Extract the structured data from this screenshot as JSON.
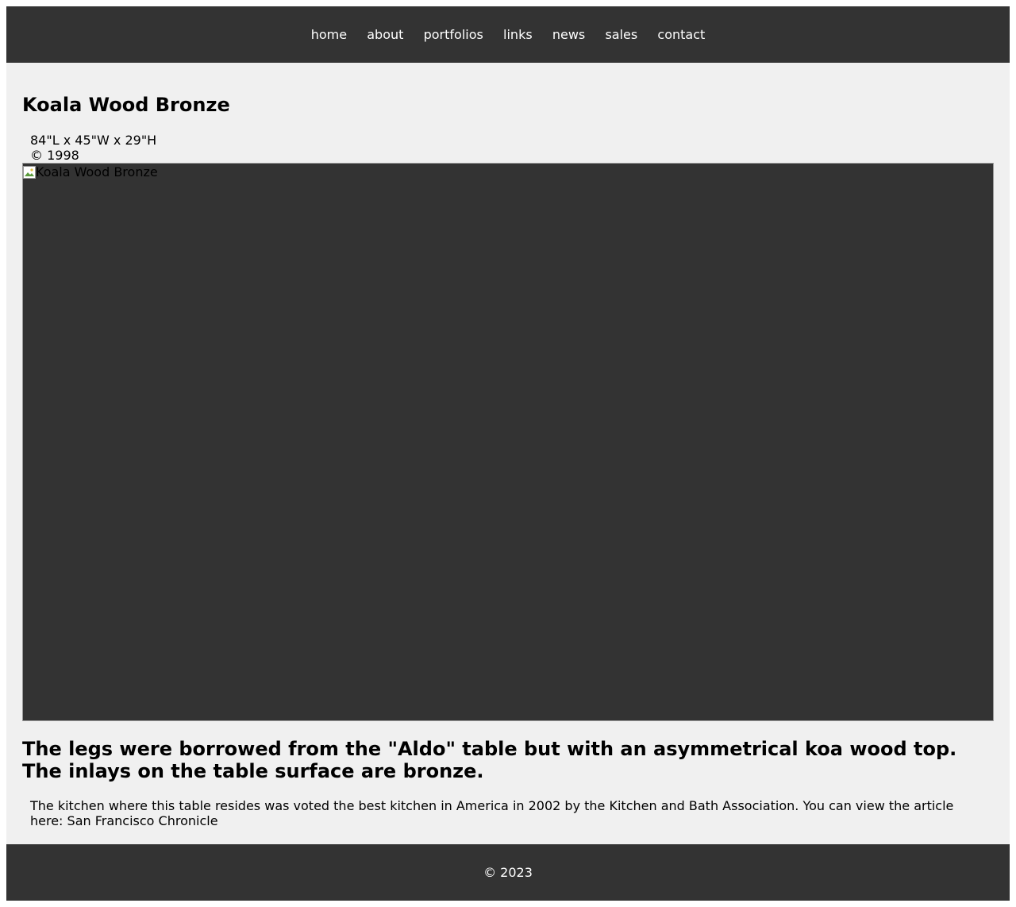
{
  "nav": {
    "items": [
      {
        "label": "home"
      },
      {
        "label": "about"
      },
      {
        "label": "portfolios"
      },
      {
        "label": "links"
      },
      {
        "label": "news"
      },
      {
        "label": "sales"
      },
      {
        "label": "contact"
      }
    ]
  },
  "artwork": {
    "title": "Koala Wood Bronze",
    "dimensions": "84\"L x 45\"W x 29\"H",
    "copyright": "© 1998",
    "image_alt": "Koala Wood Bronze",
    "description": "The legs were borrowed from the \"Aldo\" table but with an asymmetrical koa wood top. The inlays on the table surface are bronze.",
    "note_text": "The kitchen where this table resides was voted the best kitchen in America in 2002 by the Kitchen and Bath Association. You can view the article here: ",
    "note_link": "San Francisco Chronicle"
  },
  "footer": {
    "copyright": "© 2023"
  },
  "colors": {
    "header_bg": "#333333",
    "page_bg": "#f0f0f0",
    "image_placeholder_bg": "#333333",
    "nav_text": "#ffffff"
  }
}
